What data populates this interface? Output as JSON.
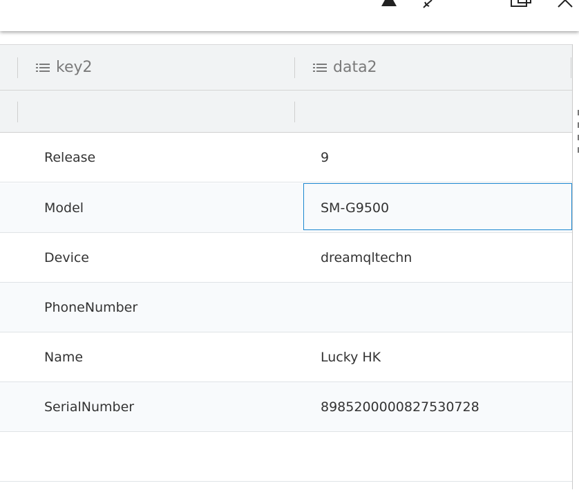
{
  "toolbar": {
    "icons": [
      "person-icon",
      "pen-icon",
      "popout-icon",
      "close-icon"
    ]
  },
  "table": {
    "columns": [
      {
        "label": "key2",
        "icon": "list-icon"
      },
      {
        "label": "data2",
        "icon": "list-icon"
      }
    ],
    "rows": [
      {
        "key": "Release",
        "value": "9"
      },
      {
        "key": "Model",
        "value": "SM-G9500",
        "selected": true
      },
      {
        "key": "Device",
        "value": "dreamqltechn"
      },
      {
        "key": "PhoneNumber",
        "value": ""
      },
      {
        "key": "Name",
        "value": "Lucky HK"
      },
      {
        "key": "SerialNumber",
        "value": "8985200000827530728"
      },
      {
        "key": "",
        "value": ""
      }
    ]
  }
}
